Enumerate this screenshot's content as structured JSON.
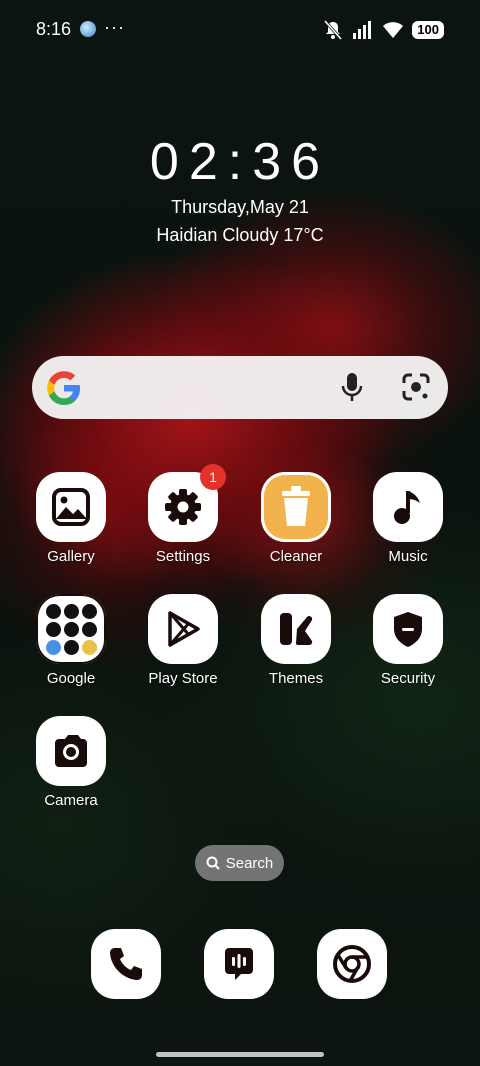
{
  "status_bar": {
    "time": "8:16",
    "dots": "···",
    "battery": "100",
    "icons": [
      "globe-icon",
      "mute-icon",
      "signal-icon",
      "wifi-icon",
      "battery-icon"
    ]
  },
  "lock_widget": {
    "clock": "02:36",
    "date": "Thursday,May 21",
    "weather": "Haidian Cloudy 17°C"
  },
  "search_bar": {
    "icons": [
      "google-logo-icon",
      "mic-icon",
      "lens-icon"
    ]
  },
  "apps": [
    {
      "label": "Gallery",
      "icon": "gallery-icon"
    },
    {
      "label": "Settings",
      "icon": "gear-icon",
      "badge": "1"
    },
    {
      "label": "Cleaner",
      "icon": "trash-icon"
    },
    {
      "label": "Music",
      "icon": "music-note-icon"
    },
    {
      "label": "Google",
      "icon": "folder-icon"
    },
    {
      "label": "Play Store",
      "icon": "play-store-icon"
    },
    {
      "label": "Themes",
      "icon": "themes-icon"
    },
    {
      "label": "Security",
      "icon": "shield-icon"
    },
    {
      "label": "Camera",
      "icon": "camera-icon"
    }
  ],
  "search_pill": {
    "label": "Search"
  },
  "dock": [
    {
      "icon": "phone-icon"
    },
    {
      "icon": "messages-icon"
    },
    {
      "icon": "chrome-icon"
    }
  ],
  "colors": {
    "badge": "#e3322b",
    "cleaner": "#f2b24c",
    "icon_fg": "#1a0b0b"
  }
}
